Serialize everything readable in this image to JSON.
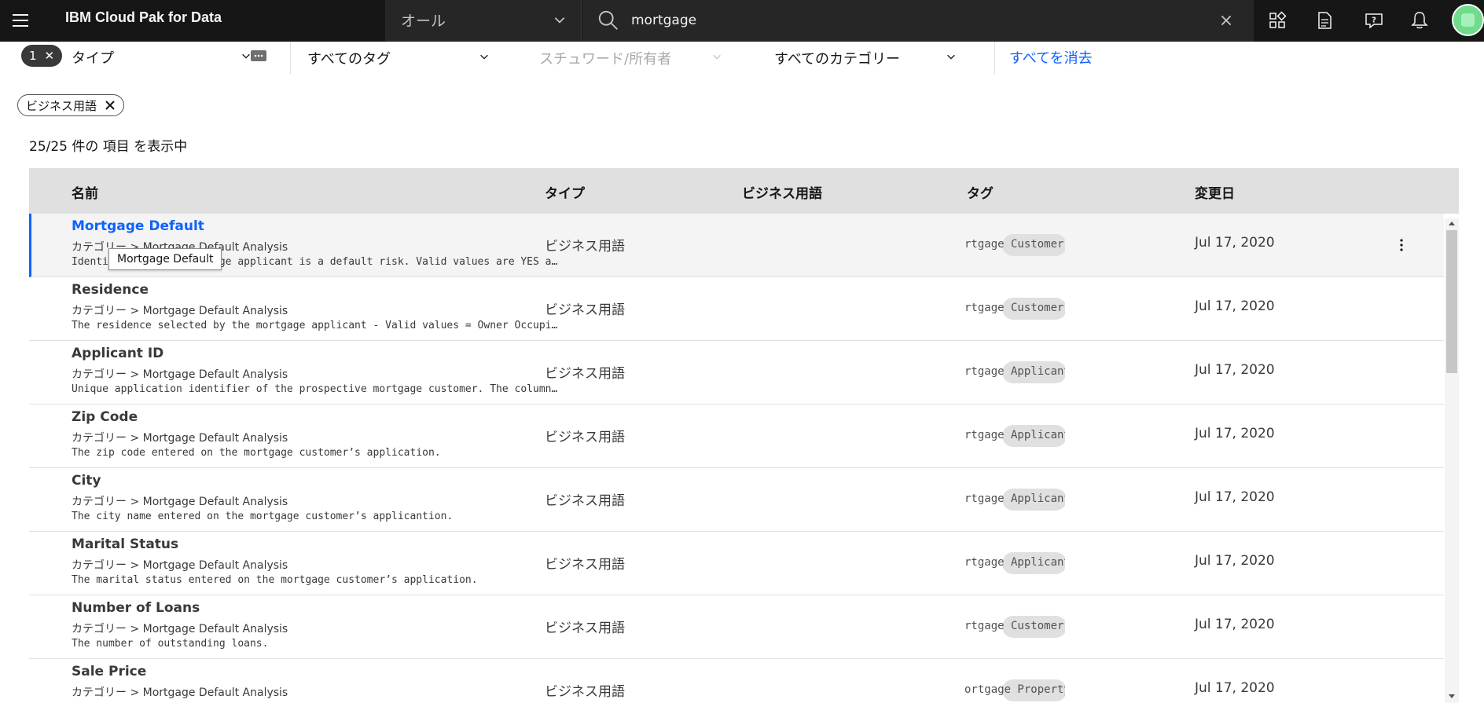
{
  "header": {
    "brand": "IBM Cloud Pak for Data",
    "scope": {
      "selected": "オール"
    },
    "search": {
      "value": "mortgage"
    },
    "icons": [
      "menu-icon",
      "chevron-down-icon",
      "search-icon",
      "close-icon",
      "app-switcher-icon",
      "document-icon",
      "help-chat-icon",
      "notification-icon",
      "avatar"
    ]
  },
  "filters": {
    "active_count": "1",
    "type_label": "タイプ",
    "tags_label": "すべてのタグ",
    "keyword_owner_label": "スチュワード/所有者",
    "categories_label": "すべてのカテゴリー",
    "clear_all_label": "すべてを消去"
  },
  "applied_chip": {
    "label": "ビジネス用語"
  },
  "result_count": "25/25 件の 項目 を表示中",
  "table": {
    "columns": {
      "name": "名前",
      "type": "タイプ",
      "business_term": "ビジネス用語",
      "tags": "タグ",
      "modified": "変更日"
    },
    "rows": [
      {
        "name": "Mortgage Default",
        "category": "カテゴリー > Mortgage Default Analysis",
        "description": "Identifies if the mortgage applicant is a default risk. Valid values are YES and NO.",
        "type": "ビジネス用語",
        "tag": "rtgage Customer",
        "date": "Jul 17, 2020"
      },
      {
        "name": "Residence",
        "category": "カテゴリー > Mortgage Default Analysis",
        "description": "The residence selected by the mortgage applicant - Valid values = Owner Occupi...",
        "type": "ビジネス用語",
        "tag": "rtgage Customer",
        "date": "Jul 17, 2020"
      },
      {
        "name": "Applicant ID",
        "category": "カテゴリー > Mortgage Default Analysis",
        "description": "Unique application identifier of the prospective mortgage customer. The column ...",
        "type": "ビジネス用語",
        "tag": "rtgage Applicant",
        "date": "Jul 17, 2020"
      },
      {
        "name": "Zip Code",
        "category": "カテゴリー > Mortgage Default Analysis",
        "description": "The zip code entered on the mortgage customer’s application.",
        "type": "ビジネス用語",
        "tag": "rtgage Applicant",
        "date": "Jul 17, 2020"
      },
      {
        "name": "City",
        "category": "カテゴリー > Mortgage Default Analysis",
        "description": "The city name entered on the mortgage customer’s applicantion.",
        "type": "ビジネス用語",
        "tag": "rtgage Applicant",
        "date": "Jul 17, 2020"
      },
      {
        "name": "Marital Status",
        "category": "カテゴリー > Mortgage Default Analysis",
        "description": "The marital status entered on the mortgage customer’s application.",
        "type": "ビジネス用語",
        "tag": "rtgage Applicant",
        "date": "Jul 17, 2020"
      },
      {
        "name": "Number of Loans",
        "category": "カテゴリー > Mortgage Default Analysis",
        "description": "The number of outstanding loans.",
        "type": "ビジネス用語",
        "tag": "rtgage Customer",
        "date": "Jul 17, 2020"
      },
      {
        "name": "Sale Price",
        "category": "カテゴリー > Mortgage Default Analysis",
        "description": "",
        "type": "ビジネス用語",
        "tag": "ortgage Property",
        "date": "Jul 17, 2020"
      }
    ]
  },
  "tooltip": {
    "text": "Mortgage Default"
  },
  "colors": {
    "header_bg": "#161616",
    "link": "#0f62fe",
    "table_header_bg": "#e0e0e0",
    "avatar": "#6fdc8c"
  }
}
